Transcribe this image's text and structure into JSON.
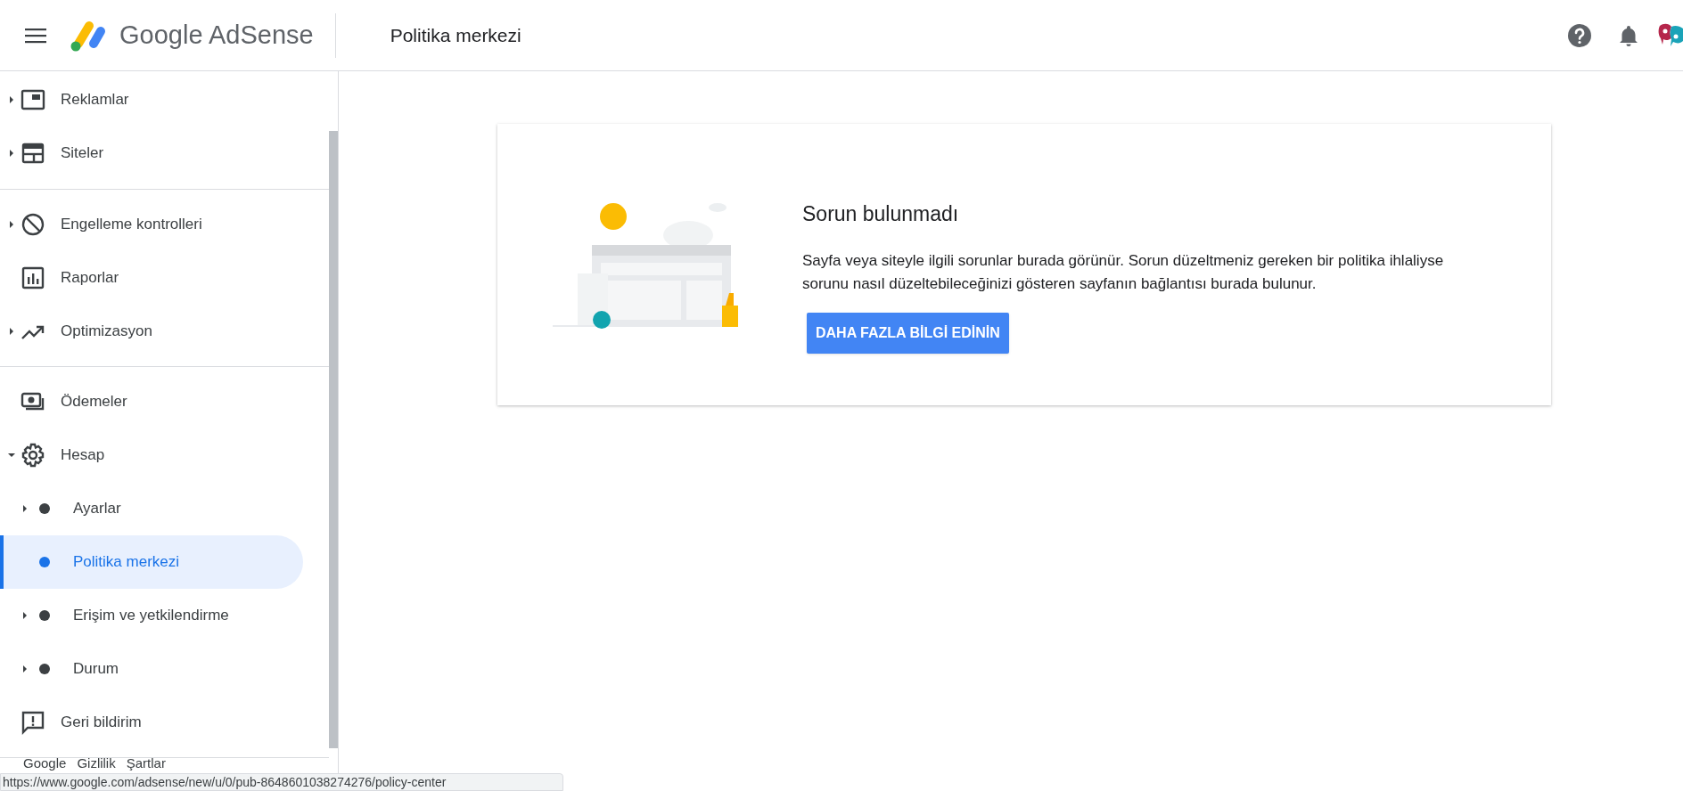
{
  "header": {
    "logo_text": "Google AdSense",
    "page_title": "Politika merkezi"
  },
  "sidebar": {
    "groups": [
      {
        "items": [
          {
            "label": "Reklamlar",
            "expanded": false,
            "selected": false
          },
          {
            "label": "Siteler",
            "expanded": false,
            "selected": false
          }
        ]
      },
      {
        "items": [
          {
            "label": "Engelleme kontrolleri",
            "expanded": false,
            "selected": false
          },
          {
            "label": "Raporlar",
            "selected": false
          },
          {
            "label": "Optimizasyon",
            "expanded": false,
            "selected": false
          }
        ]
      },
      {
        "items": [
          {
            "label": "Ödemeler",
            "selected": false
          },
          {
            "label": "Hesap",
            "expanded": true,
            "selected": false,
            "children": [
              {
                "label": "Ayarlar",
                "expanded": false,
                "selected": false
              },
              {
                "label": "Politika merkezi",
                "selected": true
              },
              {
                "label": "Erişim ve yetkilendirme",
                "expanded": false,
                "selected": false
              },
              {
                "label": "Durum",
                "expanded": false,
                "selected": false
              }
            ]
          },
          {
            "label": "Geri bildirim",
            "selected": false
          }
        ]
      }
    ],
    "footer_links": [
      "Google",
      "Gizlilik",
      "Şartlar"
    ]
  },
  "card": {
    "title": "Sorun bulunmadı",
    "body": "Sayfa veya siteyle ilgili sorunlar burada görünür. Sorun düzeltmeniz gereken bir politika ihlaliyse sorunu nasıl düzeltebileceğinizi gösteren sayfanın bağlantısı burada bulunur.",
    "button": "DAHA FAZLA BİLGİ EDİNİN"
  },
  "status_url": "https://www.google.com/adsense/new/u/0/pub-8648601038274276/policy-center"
}
